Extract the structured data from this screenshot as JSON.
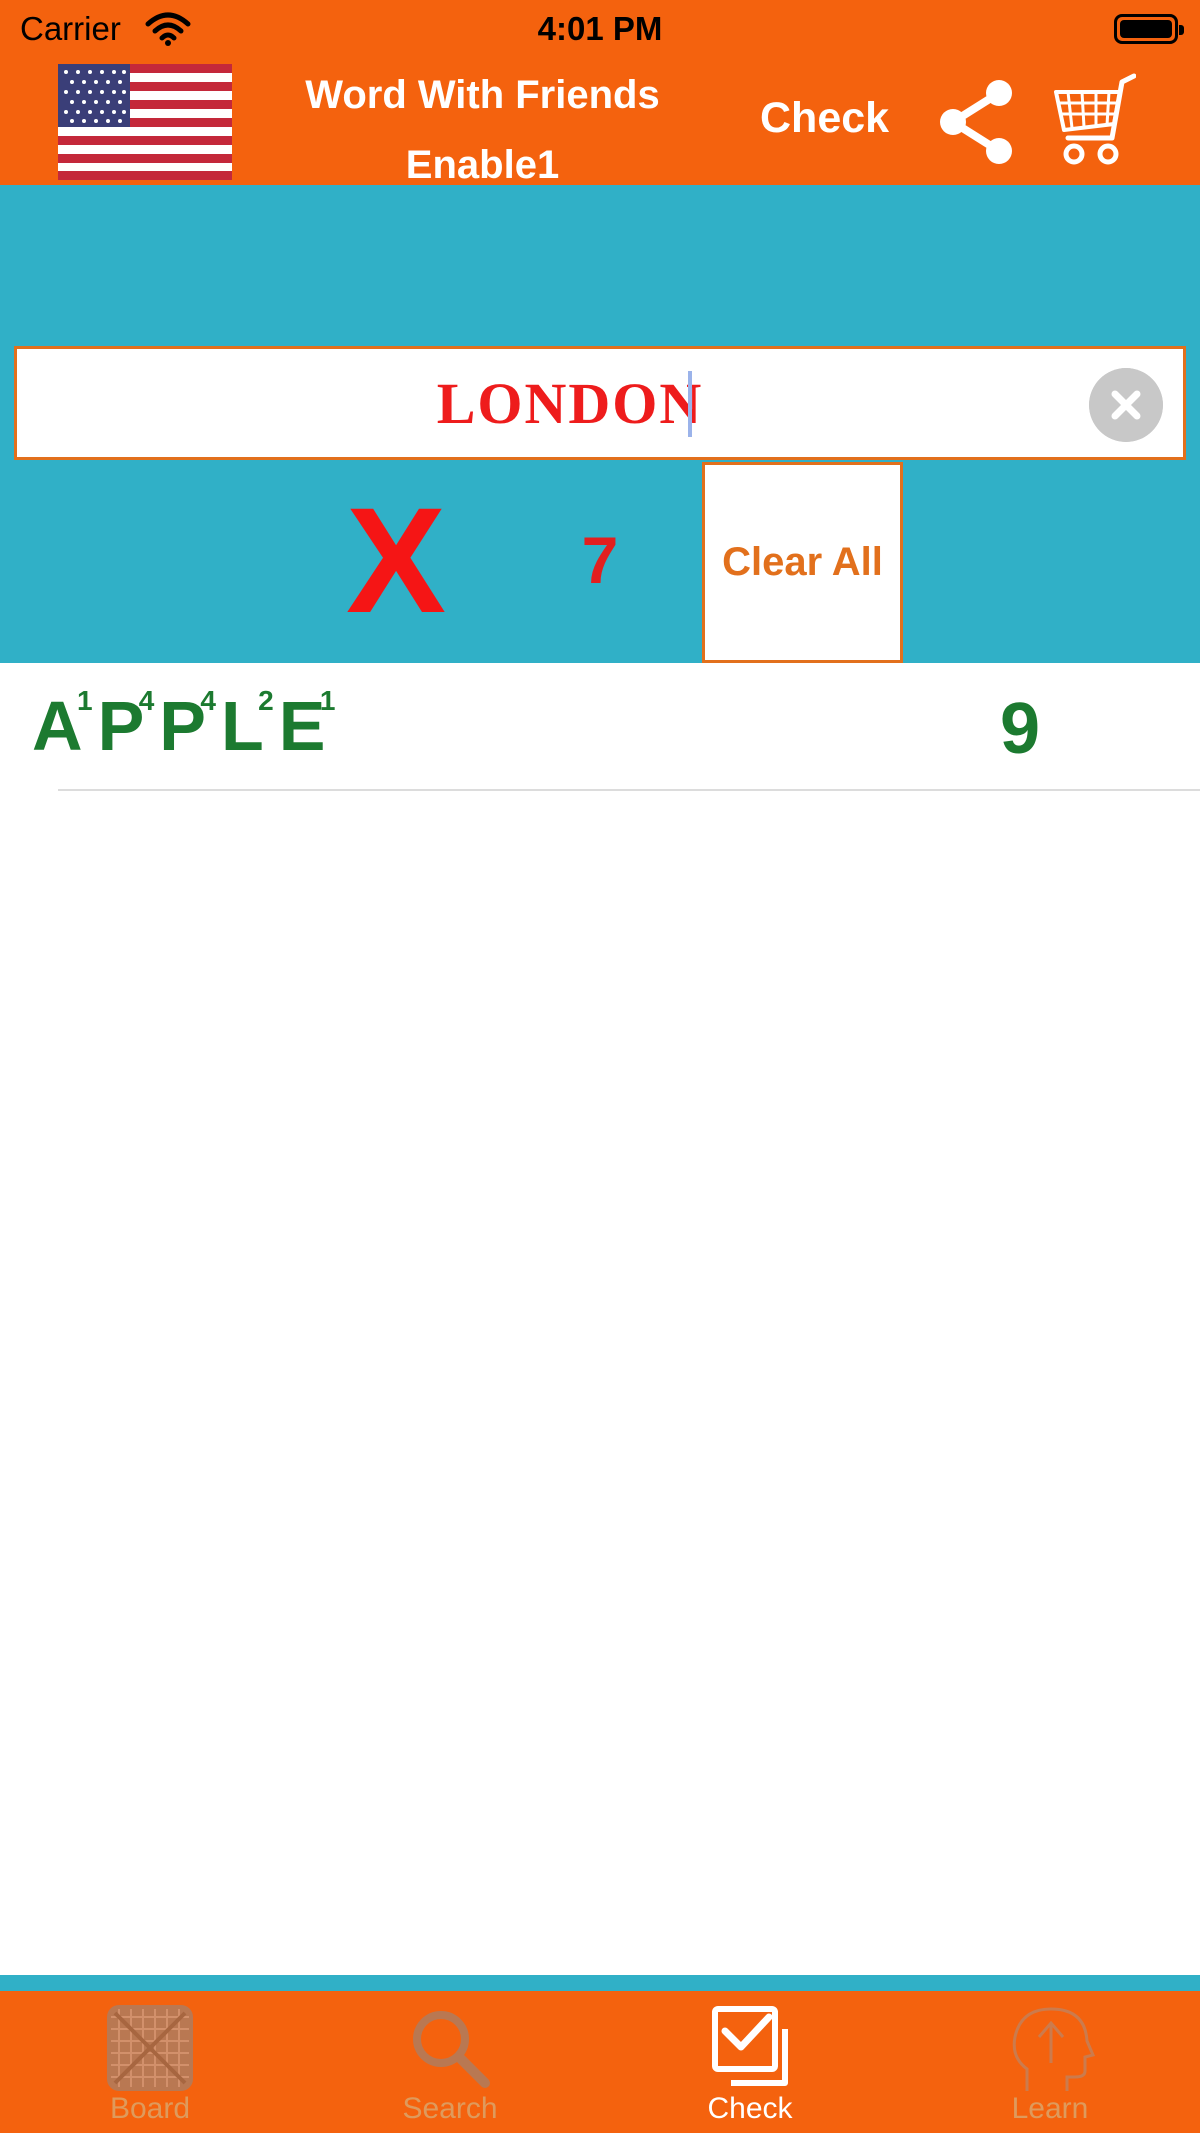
{
  "status_bar": {
    "carrier": "Carrier",
    "time": "4:01 PM"
  },
  "header": {
    "title_line1": "Word With Friends",
    "title_line2": "Enable1",
    "check_label": "Check",
    "flag_icon": "us-flag-icon",
    "share_icon": "share-icon",
    "cart_icon": "shopping-cart-icon",
    "background_color": "#f4620e"
  },
  "check_panel": {
    "background_color": "#30b0c7",
    "input_value": "LONDON",
    "result_mark": "X",
    "score": "7",
    "clear_all_label": "Clear All",
    "invalid_color": "#f51515"
  },
  "results": [
    {
      "tiles": [
        {
          "letter": "A",
          "points": "1"
        },
        {
          "letter": "P",
          "points": "4"
        },
        {
          "letter": "P",
          "points": "4"
        },
        {
          "letter": "L",
          "points": "2"
        },
        {
          "letter": "E",
          "points": "1"
        }
      ],
      "score": "9",
      "color": "#1c7a30"
    }
  ],
  "tabs": [
    {
      "label": "Board",
      "icon": "board-grid-icon",
      "active": false
    },
    {
      "label": "Search",
      "icon": "magnifier-icon",
      "active": false
    },
    {
      "label": "Check",
      "icon": "checkbox-stack-icon",
      "active": true
    },
    {
      "label": "Learn",
      "icon": "head-arrow-icon",
      "active": false
    }
  ]
}
